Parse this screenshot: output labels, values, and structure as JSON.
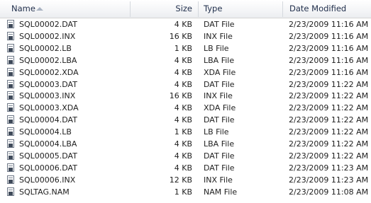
{
  "columns": {
    "name": "Name",
    "size": "Size",
    "type": "Type",
    "date": "Date Modified"
  },
  "files": [
    {
      "name": "SQL00002.DAT",
      "size": "4 KB",
      "type": "DAT File",
      "date": "2/23/2009 11:16 AM"
    },
    {
      "name": "SQL00002.INX",
      "size": "16 KB",
      "type": "INX File",
      "date": "2/23/2009 11:16 AM"
    },
    {
      "name": "SQL00002.LB",
      "size": "1 KB",
      "type": "LB File",
      "date": "2/23/2009 11:16 AM"
    },
    {
      "name": "SQL00002.LBA",
      "size": "4 KB",
      "type": "LBA File",
      "date": "2/23/2009 11:16 AM"
    },
    {
      "name": "SQL00002.XDA",
      "size": "4 KB",
      "type": "XDA File",
      "date": "2/23/2009 11:16 AM"
    },
    {
      "name": "SQL00003.DAT",
      "size": "4 KB",
      "type": "DAT File",
      "date": "2/23/2009 11:22 AM"
    },
    {
      "name": "SQL00003.INX",
      "size": "16 KB",
      "type": "INX File",
      "date": "2/23/2009 11:22 AM"
    },
    {
      "name": "SQL00003.XDA",
      "size": "4 KB",
      "type": "XDA File",
      "date": "2/23/2009 11:22 AM"
    },
    {
      "name": "SQL00004.DAT",
      "size": "4 KB",
      "type": "DAT File",
      "date": "2/23/2009 11:22 AM"
    },
    {
      "name": "SQL00004.LB",
      "size": "1 KB",
      "type": "LB File",
      "date": "2/23/2009 11:22 AM"
    },
    {
      "name": "SQL00004.LBA",
      "size": "4 KB",
      "type": "LBA File",
      "date": "2/23/2009 11:22 AM"
    },
    {
      "name": "SQL00005.DAT",
      "size": "4 KB",
      "type": "DAT File",
      "date": "2/23/2009 11:22 AM"
    },
    {
      "name": "SQL00006.DAT",
      "size": "4 KB",
      "type": "DAT File",
      "date": "2/23/2009 11:23 AM"
    },
    {
      "name": "SQL00006.INX",
      "size": "12 KB",
      "type": "INX File",
      "date": "2/23/2009 11:23 AM"
    },
    {
      "name": "SQLTAG.NAM",
      "size": "1 KB",
      "type": "NAM File",
      "date": "2/23/2009 11:08 AM"
    }
  ],
  "icons": {
    "file": "file-icon",
    "sort": "sort-ascending-arrow-icon"
  }
}
